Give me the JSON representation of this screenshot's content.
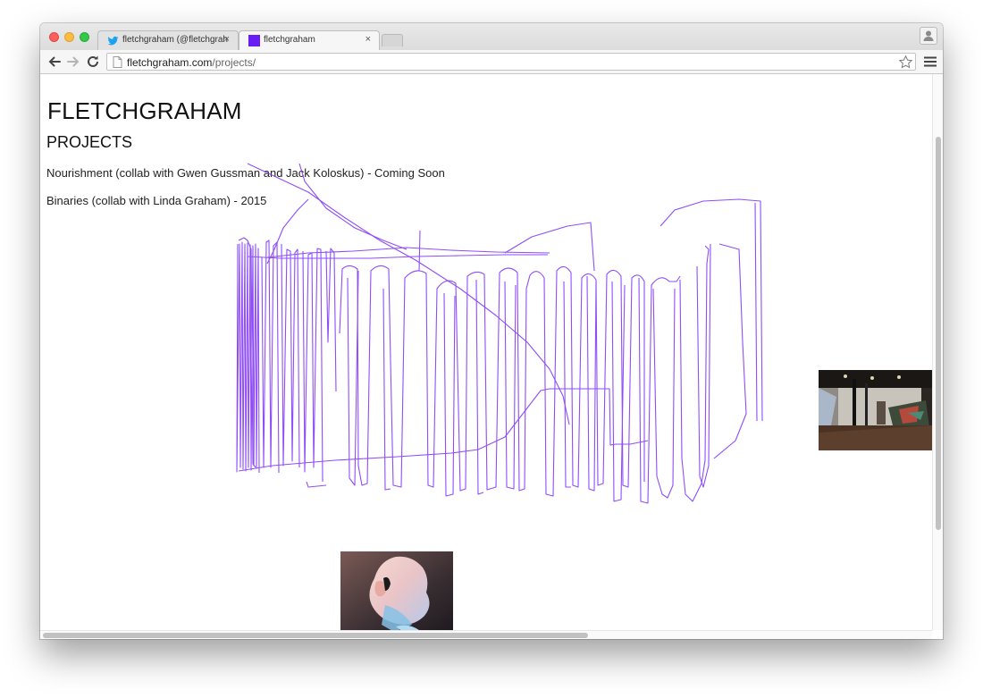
{
  "browser": {
    "tabs": [
      {
        "title": "fletchgraham (@fletchgraham)",
        "favicon": "twitter-bird-icon",
        "active": false
      },
      {
        "title": "fletchgraham",
        "favicon": "purple-square-icon",
        "active": true
      }
    ],
    "close_glyph": "×",
    "url_host": "fletchgraham.com",
    "url_path": "/projects/"
  },
  "page": {
    "site_title": "FLETCHGRAHAM",
    "section_title": "PROJECTS",
    "projects": [
      {
        "text": "Nourishment (collab with Gwen Gussman and Jack Koloskus) - Coming Soon"
      },
      {
        "text": "Binaries (collab with Linda Graham) - 2015"
      }
    ]
  },
  "colors": {
    "scribble": "#7b2ff7",
    "favicon_purple": "#6a1cf5",
    "twitter_blue": "#1da1f2"
  }
}
